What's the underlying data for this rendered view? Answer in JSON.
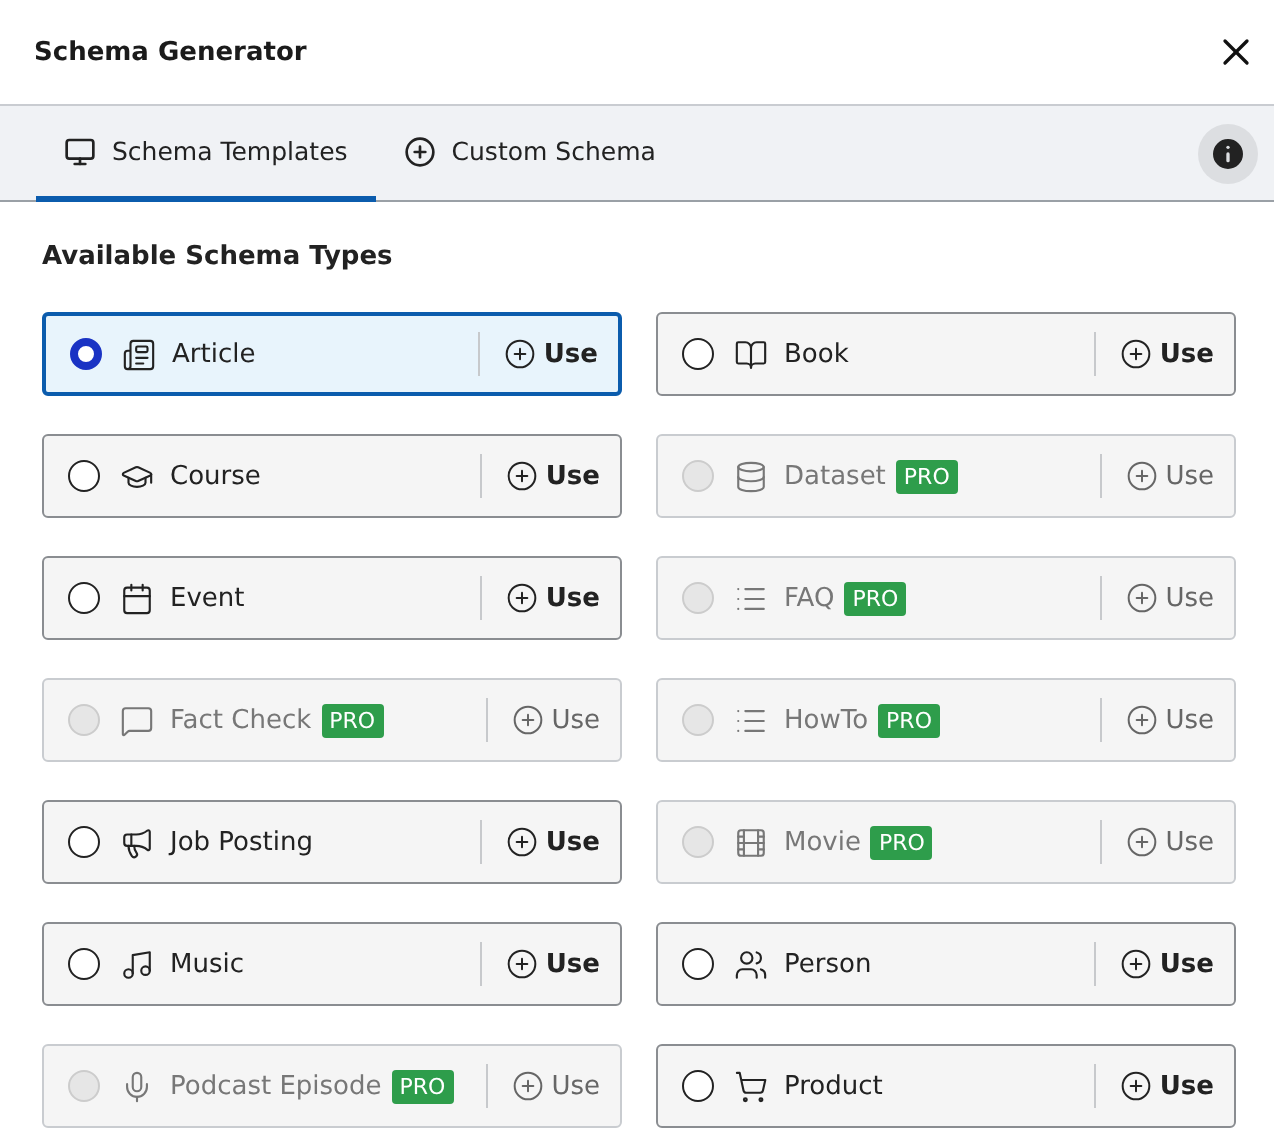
{
  "dialog": {
    "title": "Schema Generator"
  },
  "tabs": [
    {
      "label": "Schema Templates",
      "selected": true
    },
    {
      "label": "Custom Schema",
      "selected": false
    }
  ],
  "section_title": "Available Schema Types",
  "schemas": [
    {
      "name": "Article",
      "selected": true,
      "disabled": false,
      "action": "Use"
    },
    {
      "name": "Book",
      "selected": false,
      "disabled": false,
      "action": "Use"
    },
    {
      "name": "Course",
      "selected": false,
      "disabled": false,
      "action": "Use"
    },
    {
      "name": "Dataset",
      "selected": false,
      "disabled": true,
      "badge": "PRO",
      "action": "Use"
    },
    {
      "name": "Event",
      "selected": false,
      "disabled": false,
      "action": "Use"
    },
    {
      "name": "FAQ",
      "selected": false,
      "disabled": true,
      "badge": "PRO",
      "action": "Use"
    },
    {
      "name": "Fact Check",
      "selected": false,
      "disabled": true,
      "badge": "PRO",
      "action": "Use"
    },
    {
      "name": "HowTo",
      "selected": false,
      "disabled": true,
      "badge": "PRO",
      "action": "Use"
    },
    {
      "name": "Job Posting",
      "selected": false,
      "disabled": false,
      "action": "Use"
    },
    {
      "name": "Movie",
      "selected": false,
      "disabled": true,
      "badge": "PRO",
      "action": "Use"
    },
    {
      "name": "Music",
      "selected": false,
      "disabled": false,
      "action": "Use"
    },
    {
      "name": "Person",
      "selected": false,
      "disabled": false,
      "action": "Use"
    },
    {
      "name": "Podcast Episode",
      "selected": false,
      "disabled": true,
      "badge": "PRO",
      "action": "Use"
    },
    {
      "name": "Product",
      "selected": false,
      "disabled": false,
      "action": "Use"
    }
  ]
}
